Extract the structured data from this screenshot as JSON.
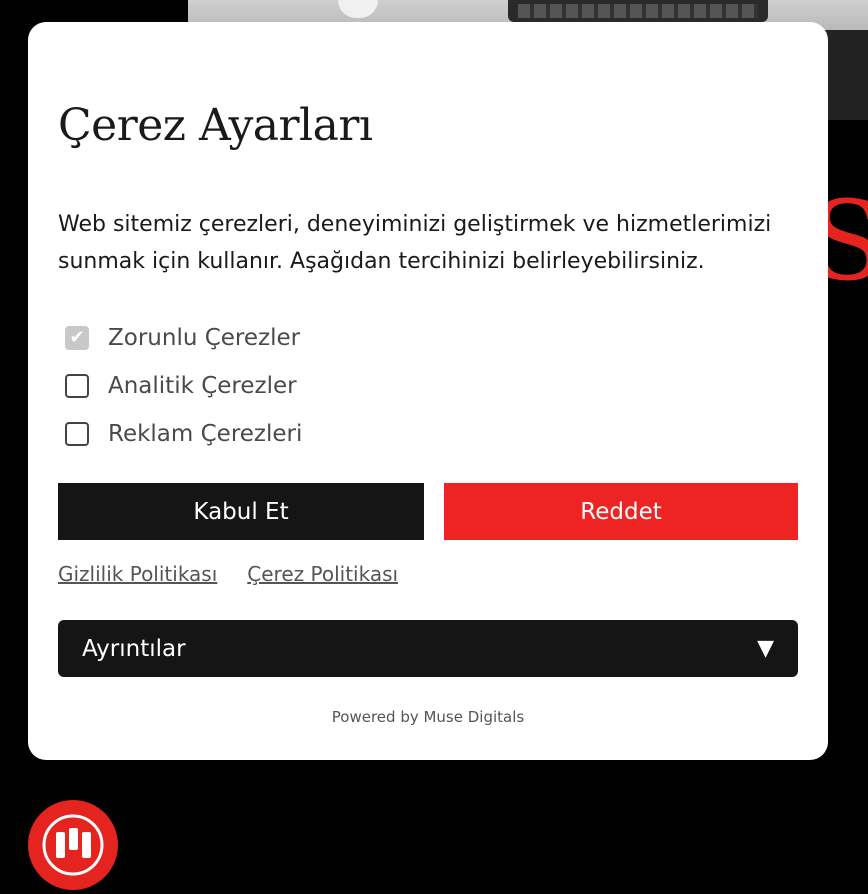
{
  "modal": {
    "title": "Çerez Ayarları",
    "description": "Web sitemiz çerezleri, deneyiminizi geliştirmek ve hizmetlerimizi sunmak için kullanır. Aşağıdan tercihinizi belirleyebilirsiniz.",
    "options": [
      {
        "label": "Zorunlu Çerezler",
        "checked": true,
        "disabled": true
      },
      {
        "label": "Analitik Çerezler",
        "checked": false,
        "disabled": false
      },
      {
        "label": "Reklam Çerezleri",
        "checked": false,
        "disabled": false
      }
    ],
    "accept_label": "Kabul Et",
    "reject_label": "Reddet",
    "links": {
      "privacy": "Gizlilik Politikası",
      "cookie": "Çerez Politikası"
    },
    "details_label": "Ayrıntılar",
    "details_arrow": "▼",
    "powered_by": "Powered by Muse Digitals"
  },
  "background": {
    "partial_letter": "S"
  },
  "colors": {
    "accent_red": "#ee2424",
    "button_dark": "#151515",
    "modal_bg": "#ffffff",
    "page_bg": "#000000"
  },
  "icons": {
    "check": "check-icon",
    "dropdown": "triangle-down-icon",
    "logo": "muse-logo-icon"
  }
}
